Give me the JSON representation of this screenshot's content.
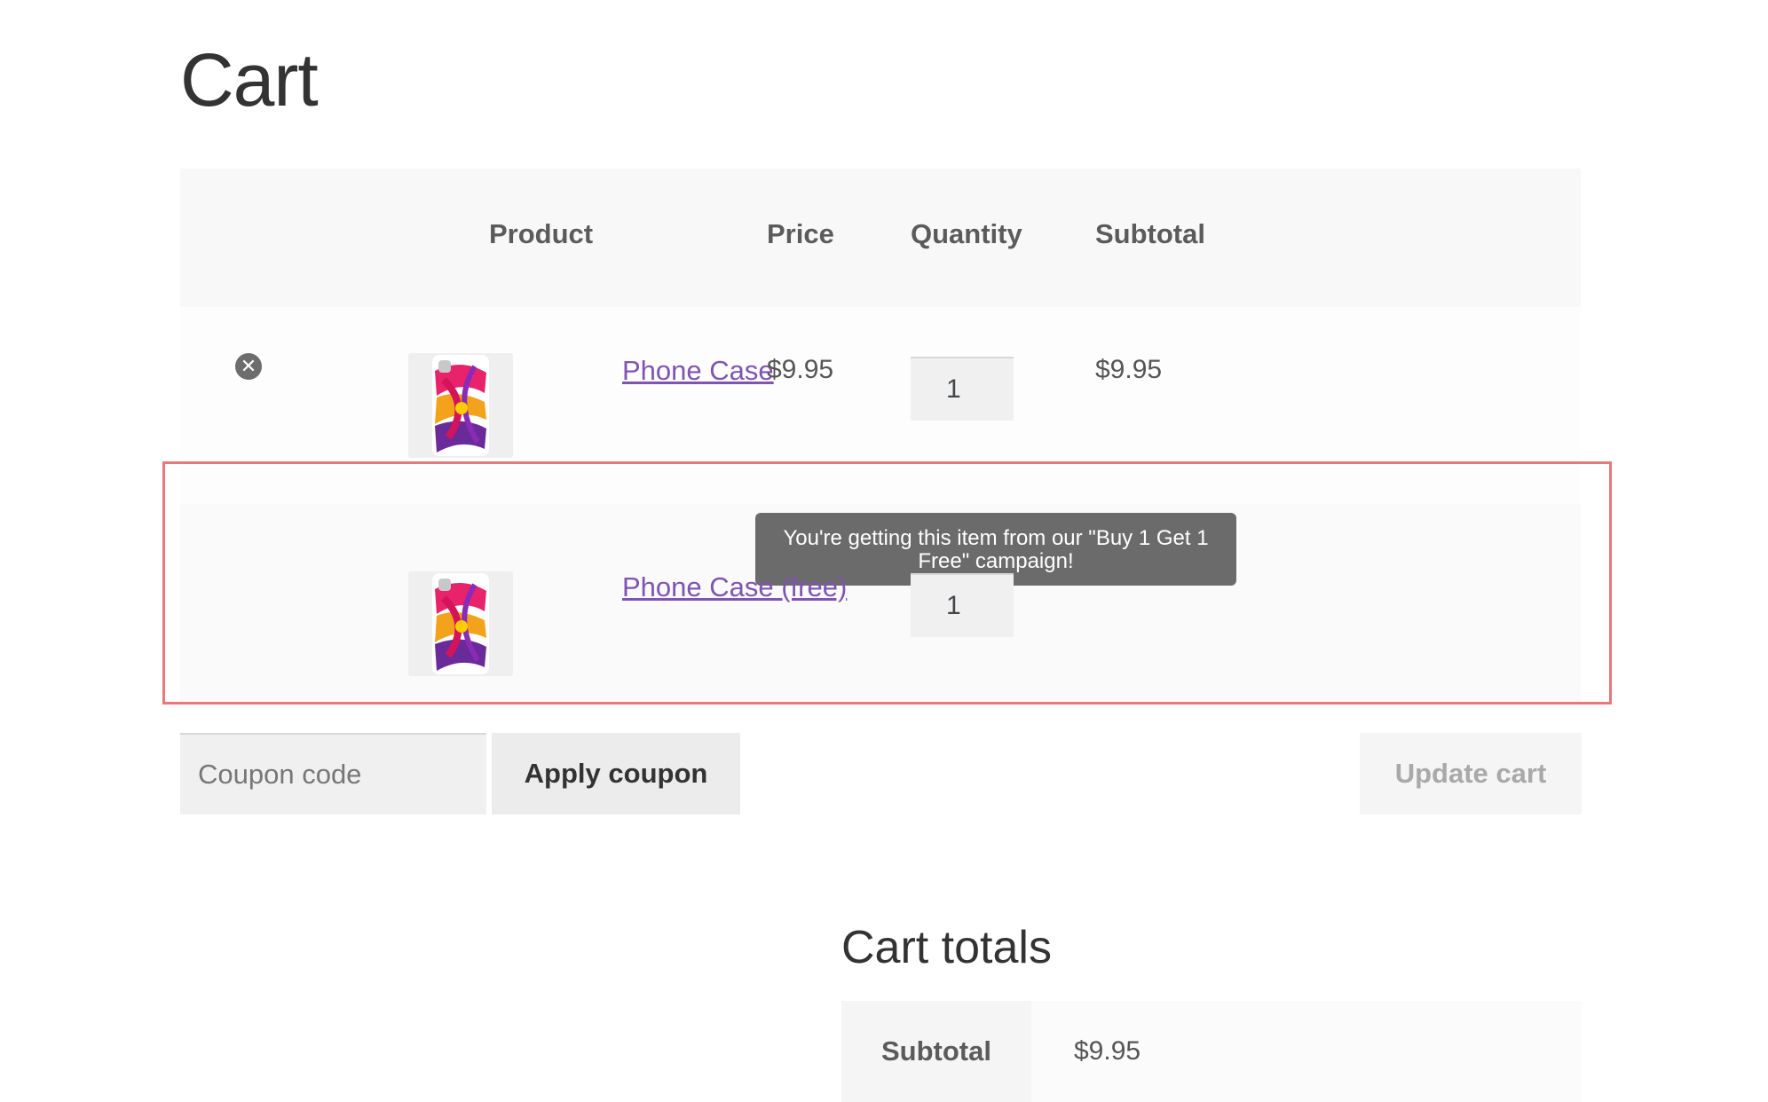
{
  "page": {
    "title": "Cart"
  },
  "table": {
    "headers": {
      "product": "Product",
      "price": "Price",
      "quantity": "Quantity",
      "subtotal": "Subtotal"
    },
    "rows": [
      {
        "name": "Phone Case",
        "price": "$9.95",
        "quantity": "1",
        "subtotal": "$9.95",
        "removable": true
      },
      {
        "name": "Phone Case (free)",
        "price": "",
        "quantity": "1",
        "subtotal": "",
        "tooltip": "You're getting this item from our \"Buy 1 Get 1 Free\" campaign!"
      }
    ]
  },
  "actions": {
    "coupon_placeholder": "Coupon code",
    "apply_coupon_label": "Apply coupon",
    "update_cart_label": "Update cart"
  },
  "totals": {
    "title": "Cart totals",
    "subtotal_label": "Subtotal",
    "subtotal_value": "$9.95"
  },
  "colors": {
    "link": "#7f54b3",
    "highlight": "#e8787a",
    "tooltip_bg": "#6b6b6b"
  },
  "icons": {
    "remove": "remove-circle-x-icon",
    "help": "question-circle-icon"
  }
}
